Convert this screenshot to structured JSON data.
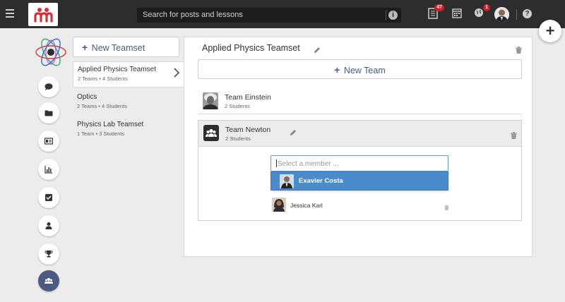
{
  "topbar": {
    "search_placeholder": "Search for posts and lessons",
    "posts_badge": "47",
    "notifications_badge": "1"
  },
  "sidebar": {
    "new_teamset_label": "New Teamset",
    "teamsets": [
      {
        "name": "Applied Physics Teamset",
        "meta": "2 Teams • 4 Students"
      },
      {
        "name": "Optics",
        "meta": "2 Teams • 4 Students"
      },
      {
        "name": "Physics Lab Teamset",
        "meta": "1 Team • 3 Students"
      }
    ]
  },
  "main": {
    "title": "Applied Physics Teamset",
    "new_team_label": "New Team",
    "teams": [
      {
        "name": "Team Einstein",
        "meta": "2 Students"
      },
      {
        "name": "Team Newton",
        "meta": "2 Students"
      }
    ],
    "member_select": {
      "placeholder": "Select a member ...",
      "option": "Exavier Costa"
    },
    "members": [
      {
        "name": "Jessica Karl"
      }
    ]
  },
  "colors": {
    "accent": "#4a5a82",
    "highlight": "#4a8ccb",
    "badge": "#c8202f",
    "topbar": "#2d2d2d"
  }
}
